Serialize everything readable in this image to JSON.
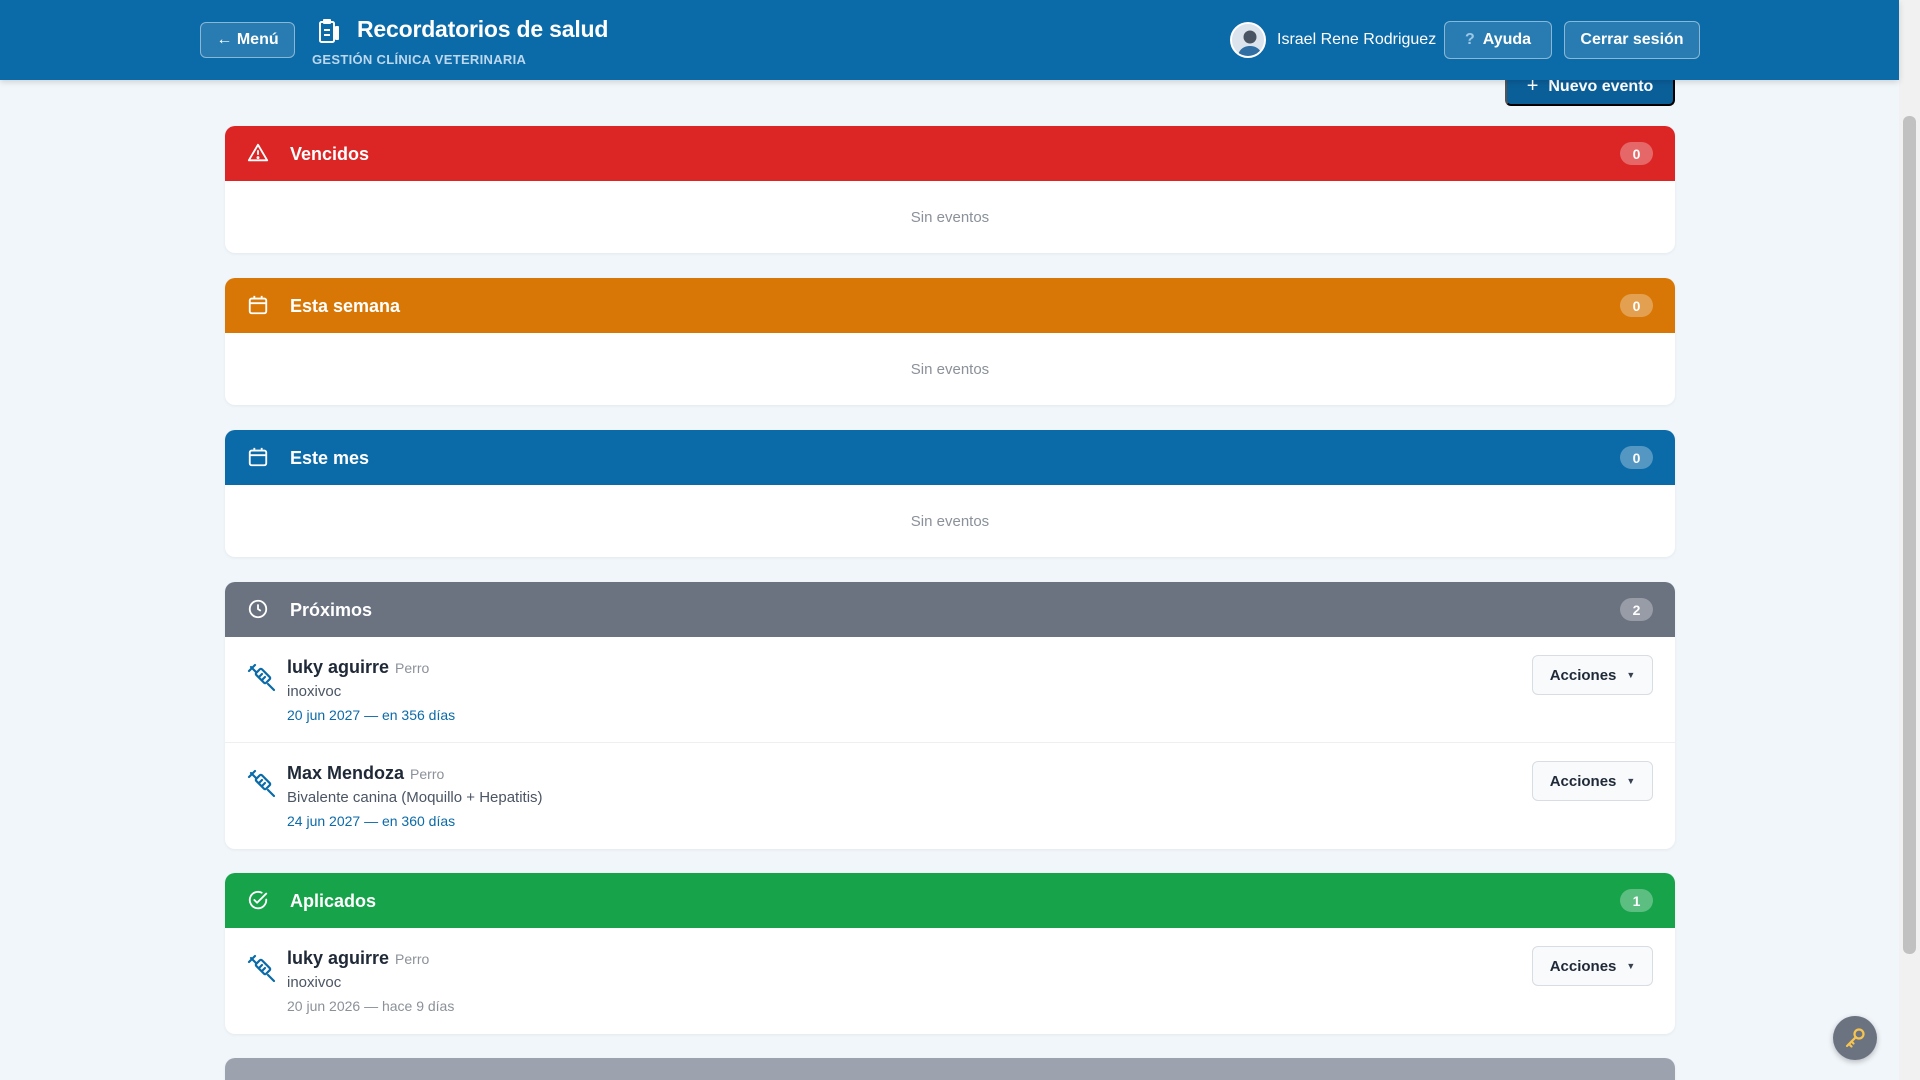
{
  "header": {
    "menu_label": "← Menú",
    "title": "Recordatorios de salud",
    "subtitle": "GESTIÓN CLÍNICA VETERINARIA",
    "user_name": "Israel Rene Rodriguez",
    "help_icon": "?",
    "help_label": "Ayuda",
    "logout_label": "Cerrar sesión"
  },
  "toolbar": {
    "new_event_icon": "+",
    "new_event_label": "Nuevo evento"
  },
  "colors": {
    "header": "#0b6aa8",
    "overdue": "#dc2626",
    "this_week": "#d97706",
    "this_month": "#0b6aa8",
    "upcoming": "#6b7280",
    "applied": "#16a34a"
  },
  "sections": {
    "overdue": {
      "icon": "warning-icon",
      "title": "Vencidos",
      "count": "0",
      "empty": "Sin eventos"
    },
    "this_week": {
      "icon": "calendar-icon",
      "title": "Esta semana",
      "count": "0",
      "empty": "Sin eventos"
    },
    "this_month": {
      "icon": "calendar-icon",
      "title": "Este mes",
      "count": "0",
      "empty": "Sin eventos"
    },
    "upcoming": {
      "icon": "clock-icon",
      "title": "Próximos",
      "count": "2",
      "items": [
        {
          "icon": "syringe-icon",
          "pet": "luky aguirre",
          "species": "Perro",
          "description": "inoxivoc",
          "date": "20 jun 2027 — en 356 días",
          "action": "Acciones"
        },
        {
          "icon": "syringe-icon",
          "pet": "Max Mendoza",
          "species": "Perro",
          "description": "Bivalente canina (Moquillo + Hepatitis)",
          "date": "24 jun 2027 — en 360 días",
          "action": "Acciones"
        }
      ]
    },
    "applied": {
      "icon": "check-circle-icon",
      "title": "Aplicados",
      "count": "1",
      "items": [
        {
          "icon": "syringe-icon",
          "pet": "luky aguirre",
          "species": "Perro",
          "description": "inoxivoc",
          "date": "20 jun 2026 — hace 9 días",
          "action": "Acciones"
        }
      ]
    }
  }
}
